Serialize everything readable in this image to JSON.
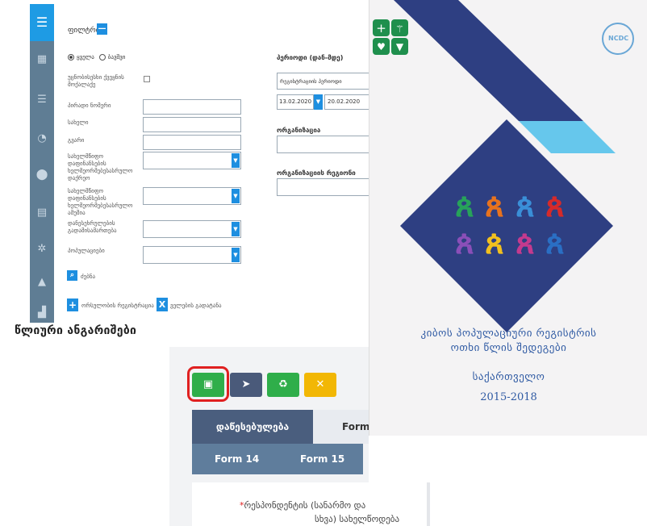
{
  "filter": {
    "title": "ფილტრი",
    "toggle": "—",
    "radio_all": "ყველა",
    "radio_other": "ბავშვი",
    "fields": [
      "უცნობისესხი ქვეყნის\nმოქალაქე",
      "პირადი ნომერი",
      "სახელი",
      "გვარი",
      "სახელმწიფო დაფინანსების\nხელმეორმებესასრულო\nდაქრეო",
      "სახელმწიფო დაფინანსების\nხელმეორმებესასრულო\nამუშია",
      "დანესეხრულების\nგადამისამართება",
      "პოპულაციები"
    ],
    "search_label": "ძებნა",
    "add_label": "ორსულობის რეგისტრაცია",
    "clear_label": "ველების გადატანა"
  },
  "right_filter": {
    "period_title": "პერიოდი (დან-მდე)",
    "period_type": "რეგისტრაციის პერიოდი",
    "date_from": "13.02.2020",
    "date_to": "20.02.2020",
    "org_title": "ორგანიზაცია",
    "org_region_title": "ორგანიზაციის რეგიონი"
  },
  "section_title": "წლიური ანგარიშები",
  "toolbar": {
    "save_icon": "floppy-icon",
    "send_icon": "paper-plane-icon",
    "recycle_icon": "recycle-icon",
    "close_icon": "x-icon",
    "colors": {
      "save": "#2fae4a",
      "send": "#4a5a7a",
      "recycle": "#2fae4a",
      "close": "#f2b705",
      "highlight": "#e02020"
    }
  },
  "tabs": [
    "დაწესებულება",
    "Form",
    "Form 14",
    "Form 15"
  ],
  "form": {
    "required_mark": "*",
    "respondent_label_line1": "რესპონდენტის (სანარმო და",
    "respondent_label_line2": "სხვა) სახელწოდება"
  },
  "poster": {
    "title_line1": "კიბოს პოპულაციური რეგისტრის",
    "title_line2": "ოთხი წლის შედეგები",
    "country": "საქართველო",
    "years": "2015-2018",
    "ribbon_colors": [
      "#27a35a",
      "#e8731e",
      "#3a8fd8",
      "#d62a2a",
      "#8a4fb8",
      "#f2c01e",
      "#c43a8e",
      "#2a6fc4"
    ]
  }
}
